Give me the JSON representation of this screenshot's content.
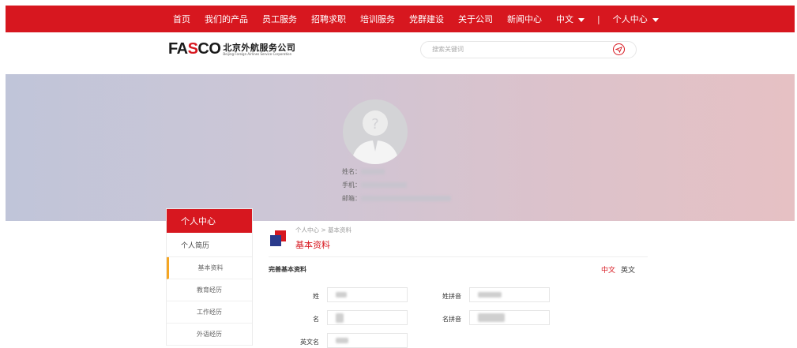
{
  "nav": {
    "items": [
      "首页",
      "我们的产品",
      "员工服务",
      "招聘求职",
      "培训服务",
      "党群建设",
      "关于公司",
      "新闻中心"
    ],
    "language": "中文",
    "separator": "|",
    "account": "个人中心"
  },
  "logo": {
    "brand_pre": "FA",
    "brand_s": "S",
    "brand_post": "CO",
    "cn": "北京外航服务公司",
    "en": "Beijing Foreign Airlines Service Corporation"
  },
  "search": {
    "placeholder": "搜索关键词",
    "icon": "plane-search-icon"
  },
  "profile": {
    "name_label": "姓名：",
    "phone_label": "手机：",
    "email_label": "邮箱："
  },
  "sidebar": {
    "header": "个人中心",
    "section": "个人简历",
    "items": [
      "基本资料",
      "教育经历",
      "工作经历",
      "外语经历"
    ],
    "active_index": 0
  },
  "content": {
    "breadcrumb": "个人中心 > 基本资料",
    "title": "基本资料",
    "section": "完善基本资料",
    "lang_zh": "中文",
    "lang_en": "英文",
    "fields": {
      "surname": "姓",
      "surname_pinyin": "姓拼音",
      "given": "名",
      "given_pinyin": "名拼音",
      "english_name": "英文名"
    }
  },
  "colors": {
    "accent": "#d7171f",
    "active_marker": "#f5a623"
  }
}
